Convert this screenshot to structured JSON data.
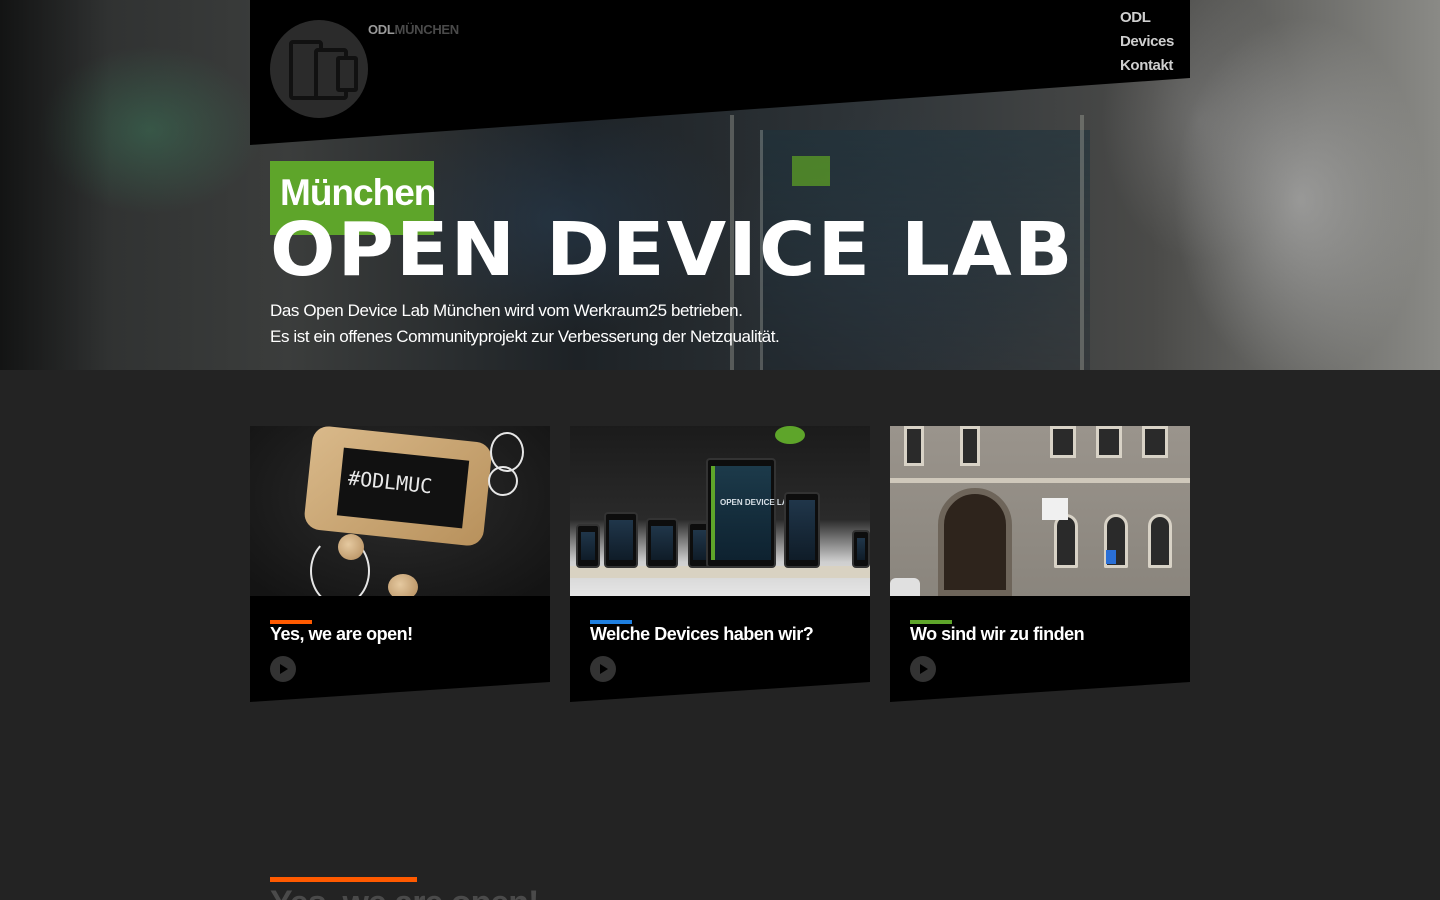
{
  "header": {
    "logo": {
      "part1": "ODL",
      "part2": "MÜNCHEN"
    },
    "nav": [
      {
        "label": "ODL"
      },
      {
        "label": "Devices"
      },
      {
        "label": "Kontakt"
      }
    ]
  },
  "hero": {
    "city": "München",
    "title": "OPEN DEVICE LAB",
    "description_line1": "Das Open Device Lab München wird vom Werkraum25 betrieben.",
    "description_line2": "Es ist ein offenes Communityprojekt zur Verbesserung der Netzqualität.",
    "badge_color": "#5ea52a"
  },
  "cards": [
    {
      "title": "Yes, we are open!",
      "accent_color": "#ff5a00",
      "image_text": "#ODLMUC",
      "icon": "play-icon"
    },
    {
      "title": "Welche Devices haben wir?",
      "accent_color": "#1e7fe0",
      "image_text": "OPEN DEVICE LAB",
      "icon": "play-icon"
    },
    {
      "title": "Wo sind wir zu finden",
      "accent_color": "#5ea52a",
      "icon": "play-icon"
    }
  ],
  "section": {
    "title": "Yes, we are open!",
    "accent_color": "#ff5a00"
  }
}
